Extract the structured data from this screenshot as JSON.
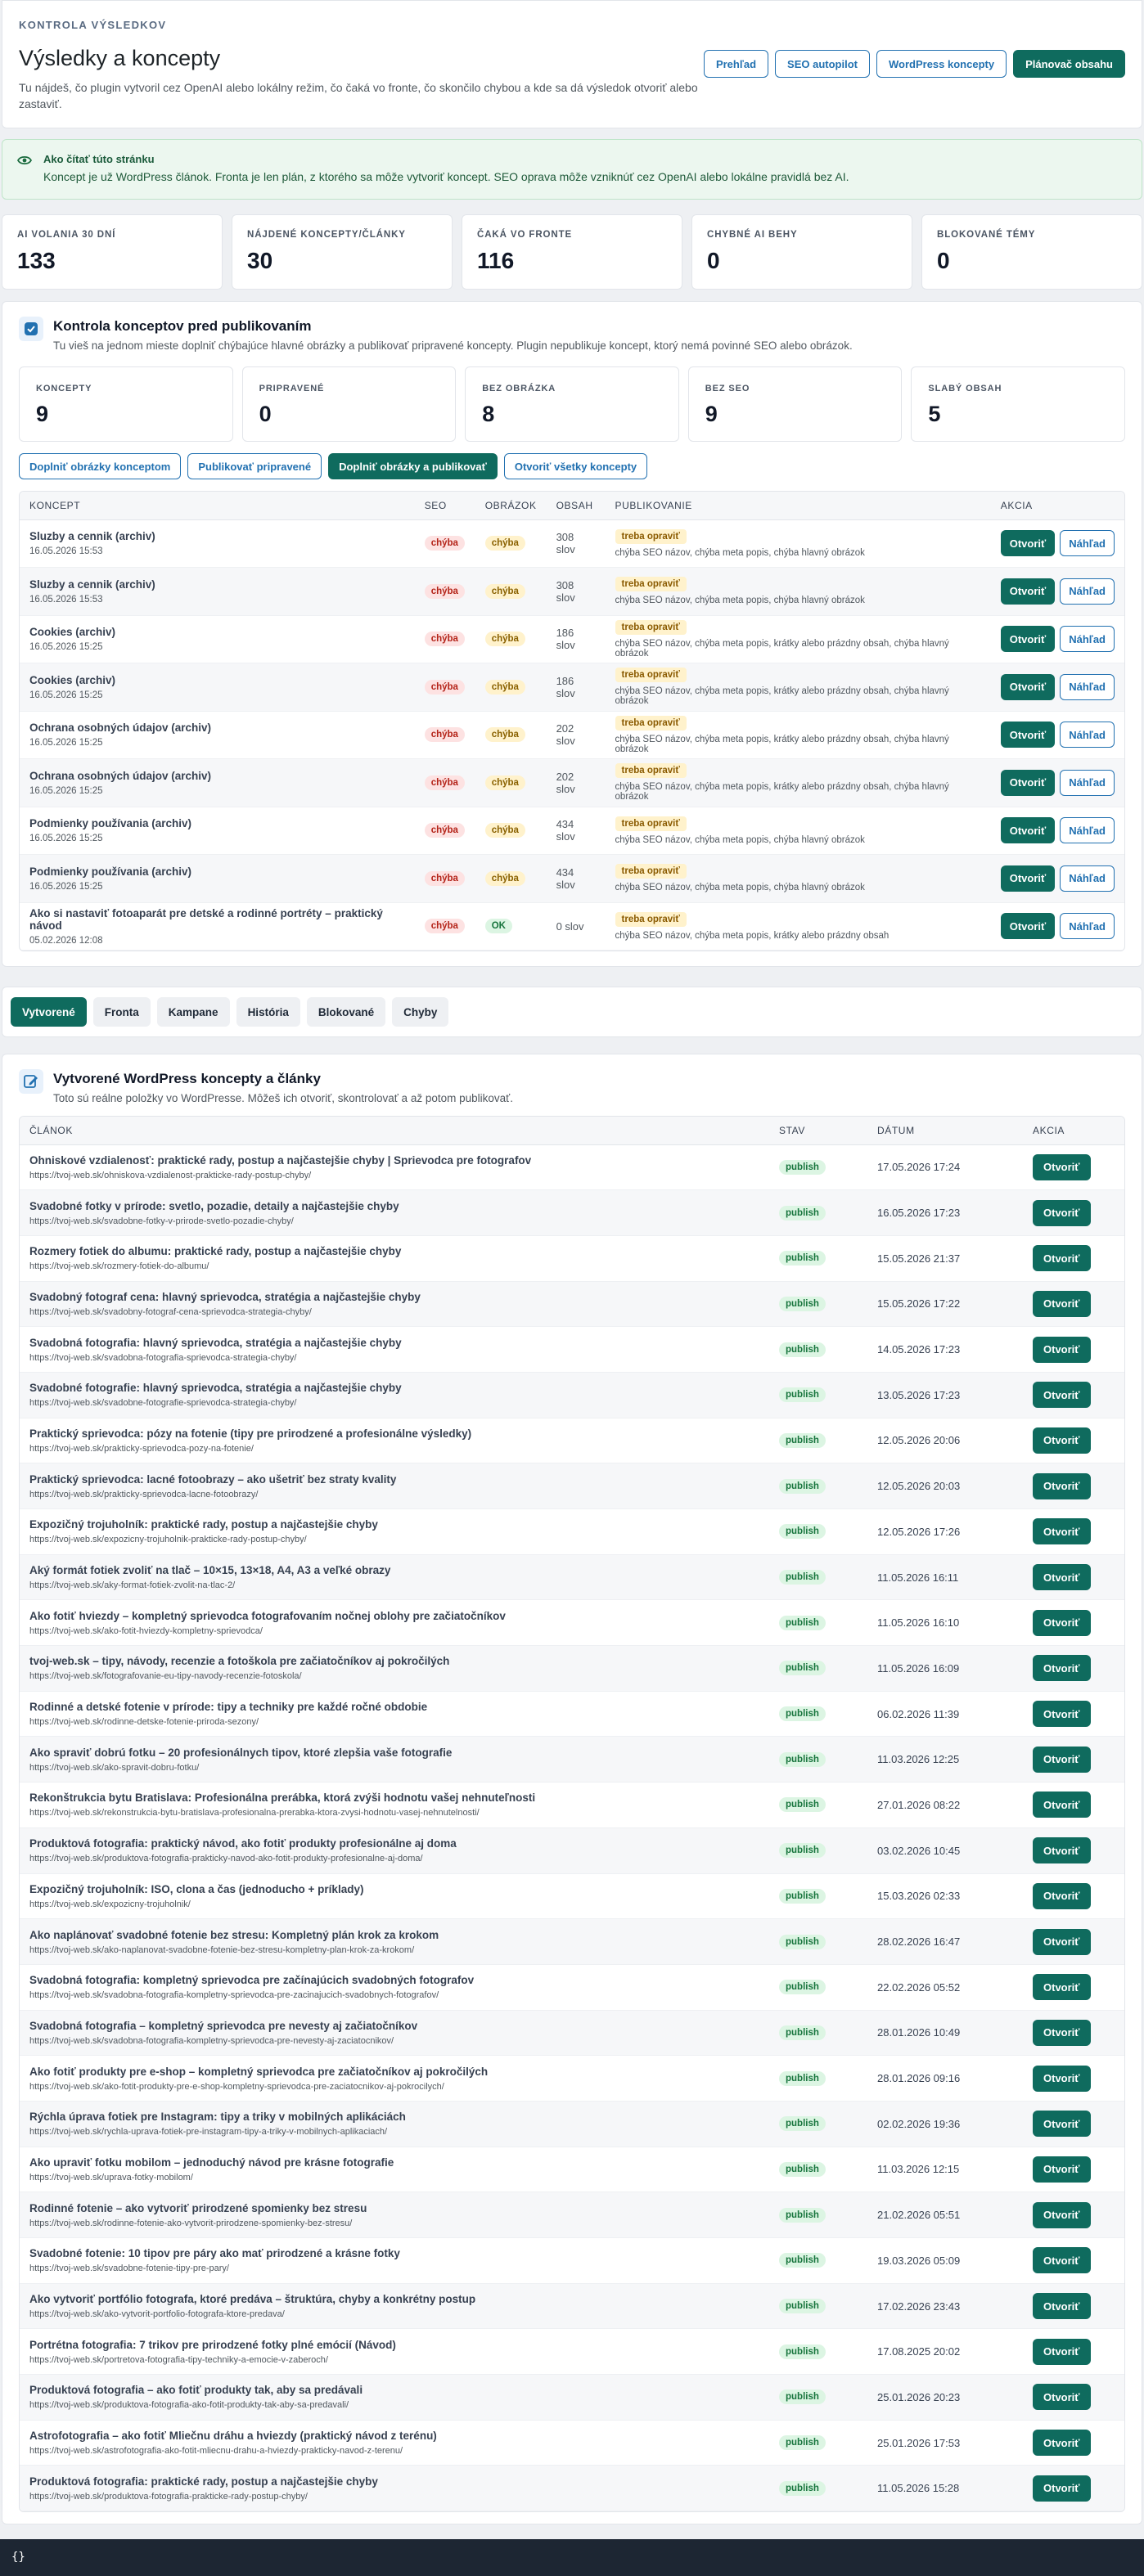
{
  "header": {
    "eyebrow": "KONTROLA VÝSLEDKOV",
    "title": "Výsledky a koncepty",
    "subtitle": "Tu nájdeš, čo plugin vytvoril cez OpenAI alebo lokálny režim, čo čaká vo fronte, čo skončilo chybou a kde sa dá výsledok otvoriť alebo zastaviť.",
    "actions": [
      "Prehľad",
      "SEO autopilot",
      "WordPress koncepty",
      "Plánovač obsahu"
    ]
  },
  "notice": {
    "title": "Ako čítať túto stránku",
    "text": "Koncept je už WordPress článok. Fronta je len plán, z ktorého sa môže vytvoriť koncept. SEO oprava môže vzniknúť cez OpenAI alebo lokálne pravidlá bez AI."
  },
  "stats": [
    {
      "label": "AI VOLANIA 30 DNÍ",
      "value": "133"
    },
    {
      "label": "NÁJDENÉ KONCEPTY/ČLÁNKY",
      "value": "30"
    },
    {
      "label": "ČAKÁ VO FRONTE",
      "value": "116"
    },
    {
      "label": "CHYBNÉ AI BEHY",
      "value": "0"
    },
    {
      "label": "BLOKOVANÉ TÉMY",
      "value": "0"
    }
  ],
  "review": {
    "title": "Kontrola konceptov pred publikovaním",
    "subtitle": "Tu vieš na jednom mieste doplniť chýbajúce hlavné obrázky a publikovať pripravené koncepty. Plugin nepublikuje koncept, ktorý nemá povinné SEO alebo obrázok.",
    "stats": [
      {
        "label": "KONCEPTY",
        "value": "9"
      },
      {
        "label": "PRIPRAVENÉ",
        "value": "0"
      },
      {
        "label": "BEZ OBRÁZKA",
        "value": "8"
      },
      {
        "label": "BEZ SEO",
        "value": "9"
      },
      {
        "label": "SLABÝ OBSAH",
        "value": "5"
      }
    ],
    "bulk_actions": [
      "Doplniť obrázky konceptom",
      "Publikovať pripravené",
      "Doplniť obrázky a publikovať",
      "Otvoriť všetky koncepty"
    ],
    "columns": [
      "KONCEPT",
      "SEO",
      "OBRÁZOK",
      "OBSAH",
      "PUBLIKOVANIE",
      "AKCIA"
    ],
    "open_label": "Otvoriť",
    "preview_label": "Náhľad",
    "rows": [
      {
        "title": "Sluzby a cennik (archiv)",
        "date": "16.05.2026 15:53",
        "seo": "chýba",
        "image": "chýba",
        "content": "308 slov",
        "status": "treba opraviť",
        "note": "chýba SEO názov, chýba meta popis, chýba hlavný obrázok"
      },
      {
        "title": "Sluzby a cennik (archiv)",
        "date": "16.05.2026 15:53",
        "seo": "chýba",
        "image": "chýba",
        "content": "308 slov",
        "status": "treba opraviť",
        "note": "chýba SEO názov, chýba meta popis, chýba hlavný obrázok"
      },
      {
        "title": "Cookies (archiv)",
        "date": "16.05.2026 15:25",
        "seo": "chýba",
        "image": "chýba",
        "content": "186 slov",
        "status": "treba opraviť",
        "note": "chýba SEO názov, chýba meta popis, krátky alebo prázdny obsah, chýba hlavný obrázok"
      },
      {
        "title": "Cookies (archiv)",
        "date": "16.05.2026 15:25",
        "seo": "chýba",
        "image": "chýba",
        "content": "186 slov",
        "status": "treba opraviť",
        "note": "chýba SEO názov, chýba meta popis, krátky alebo prázdny obsah, chýba hlavný obrázok"
      },
      {
        "title": "Ochrana osobných údajov (archiv)",
        "date": "16.05.2026 15:25",
        "seo": "chýba",
        "image": "chýba",
        "content": "202 slov",
        "status": "treba opraviť",
        "note": "chýba SEO názov, chýba meta popis, krátky alebo prázdny obsah, chýba hlavný obrázok"
      },
      {
        "title": "Ochrana osobných údajov (archiv)",
        "date": "16.05.2026 15:25",
        "seo": "chýba",
        "image": "chýba",
        "content": "202 slov",
        "status": "treba opraviť",
        "note": "chýba SEO názov, chýba meta popis, krátky alebo prázdny obsah, chýba hlavný obrázok"
      },
      {
        "title": "Podmienky používania (archiv)",
        "date": "16.05.2026 15:25",
        "seo": "chýba",
        "image": "chýba",
        "content": "434 slov",
        "status": "treba opraviť",
        "note": "chýba SEO názov, chýba meta popis, chýba hlavný obrázok"
      },
      {
        "title": "Podmienky používania (archiv)",
        "date": "16.05.2026 15:25",
        "seo": "chýba",
        "image": "chýba",
        "content": "434 slov",
        "status": "treba opraviť",
        "note": "chýba SEO názov, chýba meta popis, chýba hlavný obrázok"
      },
      {
        "title": "Ako si nastaviť fotoaparát pre detské a rodinné portréty – praktický návod",
        "date": "05.02.2026 12:08",
        "seo": "chýba",
        "image": "OK",
        "content": "0 slov",
        "status": "treba opraviť",
        "note": "chýba SEO názov, chýba meta popis, krátky alebo prázdny obsah"
      }
    ]
  },
  "tabs": [
    "Vytvorené",
    "Fronta",
    "Kampane",
    "História",
    "Blokované",
    "Chyby"
  ],
  "created": {
    "title": "Vytvorené WordPress koncepty a články",
    "subtitle": "Toto sú reálne položky vo WordPresse. Môžeš ich otvoriť, skontrolovať a až potom publikovať.",
    "columns": [
      "ČLÁNOK",
      "STAV",
      "DÁTUM",
      "AKCIA"
    ],
    "open_label": "Otvoriť",
    "rows": [
      {
        "title": "Ohniskové vzdialenosť: praktické rady, postup a najčastejšie chyby | Sprievodca pre fotografov",
        "url": "https://tvoj-web.sk/ohniskova-vzdialenost-prakticke-rady-postup-chyby/",
        "status": "publish",
        "date": "17.05.2026 17:24"
      },
      {
        "title": "Svadobné fotky v prírode: svetlo, pozadie, detaily a najčastejšie chyby",
        "url": "https://tvoj-web.sk/svadobne-fotky-v-prirode-svetlo-pozadie-chyby/",
        "status": "publish",
        "date": "16.05.2026 17:23"
      },
      {
        "title": "Rozmery fotiek do albumu: praktické rady, postup a najčastejšie chyby",
        "url": "https://tvoj-web.sk/rozmery-fotiek-do-albumu/",
        "status": "publish",
        "date": "15.05.2026 21:37"
      },
      {
        "title": "Svadobný fotograf cena: hlavný sprievodca, stratégia a najčastejšie chyby",
        "url": "https://tvoj-web.sk/svadobny-fotograf-cena-sprievodca-strategia-chyby/",
        "status": "publish",
        "date": "15.05.2026 17:22"
      },
      {
        "title": "Svadobná fotografia: hlavný sprievodca, stratégia a najčastejšie chyby",
        "url": "https://tvoj-web.sk/svadobna-fotografia-sprievodca-strategia-chyby/",
        "status": "publish",
        "date": "14.05.2026 17:23"
      },
      {
        "title": "Svadobné fotografie: hlavný sprievodca, stratégia a najčastejšie chyby",
        "url": "https://tvoj-web.sk/svadobne-fotografie-sprievodca-strategia-chyby/",
        "status": "publish",
        "date": "13.05.2026 17:23"
      },
      {
        "title": "Praktický sprievodca: pózy na fotenie (tipy pre prirodzené a profesionálne výsledky)",
        "url": "https://tvoj-web.sk/prakticky-sprievodca-pozy-na-fotenie/",
        "status": "publish",
        "date": "12.05.2026 20:06"
      },
      {
        "title": "Praktický sprievodca: lacné fotoobrazy – ako ušetriť bez straty kvality",
        "url": "https://tvoj-web.sk/prakticky-sprievodca-lacne-fotoobrazy/",
        "status": "publish",
        "date": "12.05.2026 20:03"
      },
      {
        "title": "Expozičný trojuholník: praktické rady, postup a najčastejšie chyby",
        "url": "https://tvoj-web.sk/expozicny-trojuholnik-prakticke-rady-postup-chyby/",
        "status": "publish",
        "date": "12.05.2026 17:26"
      },
      {
        "title": "Aký formát fotiek zvoliť na tlač – 10×15, 13×18, A4, A3 a veľké obrazy",
        "url": "https://tvoj-web.sk/aky-format-fotiek-zvolit-na-tlac-2/",
        "status": "publish",
        "date": "11.05.2026 16:11"
      },
      {
        "title": "Ako fotiť hviezdy – kompletný sprievodca fotografovaním nočnej oblohy pre začiatočníkov",
        "url": "https://tvoj-web.sk/ako-fotit-hviezdy-kompletny-sprievodca/",
        "status": "publish",
        "date": "11.05.2026 16:10"
      },
      {
        "title": "tvoj-web.sk – tipy, návody, recenzie a fotoškola pre začiatočníkov aj pokročilých",
        "url": "https://tvoj-web.sk/fotografovanie-eu-tipy-navody-recenzie-fotoskola/",
        "status": "publish",
        "date": "11.05.2026 16:09"
      },
      {
        "title": "Rodinné a detské fotenie v prírode: tipy a techniky pre každé ročné obdobie",
        "url": "https://tvoj-web.sk/rodinne-detske-fotenie-priroda-sezony/",
        "status": "publish",
        "date": "06.02.2026 11:39"
      },
      {
        "title": "Ako spraviť dobrú fotku – 20 profesionálnych tipov, ktoré zlepšia vaše fotografie",
        "url": "https://tvoj-web.sk/ako-spravit-dobru-fotku/",
        "status": "publish",
        "date": "11.03.2026 12:25"
      },
      {
        "title": "Rekonštrukcia bytu Bratislava: Profesionálna prerábka, ktorá zvýši hodnotu vašej nehnuteľnosti",
        "url": "https://tvoj-web.sk/rekonstrukcia-bytu-bratislava-profesionalna-prerabka-ktora-zvysi-hodnotu-vasej-nehnutelnosti/",
        "status": "publish",
        "date": "27.01.2026 08:22"
      },
      {
        "title": "Produktová fotografia: praktický návod, ako fotiť produkty profesionálne aj doma",
        "url": "https://tvoj-web.sk/produktova-fotografia-prakticky-navod-ako-fotit-produkty-profesionalne-aj-doma/",
        "status": "publish",
        "date": "03.02.2026 10:45"
      },
      {
        "title": "Expozičný trojuholník: ISO, clona a čas (jednoducho + príklady)",
        "url": "https://tvoj-web.sk/expozicny-trojuholnik/",
        "status": "publish",
        "date": "15.03.2026 02:33"
      },
      {
        "title": "Ako naplánovať svadobné fotenie bez stresu: Kompletný plán krok za krokom",
        "url": "https://tvoj-web.sk/ako-naplanovat-svadobne-fotenie-bez-stresu-kompletny-plan-krok-za-krokom/",
        "status": "publish",
        "date": "28.02.2026 16:47"
      },
      {
        "title": "Svadobná fotografia: kompletný sprievodca pre začínajúcich svadobných fotografov",
        "url": "https://tvoj-web.sk/svadobna-fotografia-kompletny-sprievodca-pre-zacinajucich-svadobnych-fotografov/",
        "status": "publish",
        "date": "22.02.2026 05:52"
      },
      {
        "title": "Svadobná fotografia – kompletný sprievodca pre nevesty aj začiatočníkov",
        "url": "https://tvoj-web.sk/svadobna-fotografia-kompletny-sprievodca-pre-nevesty-aj-zaciatocnikov/",
        "status": "publish",
        "date": "28.01.2026 10:49"
      },
      {
        "title": "Ako fotiť produkty pre e-shop – kompletný sprievodca pre začiatočníkov aj pokročilých",
        "url": "https://tvoj-web.sk/ako-fotit-produkty-pre-e-shop-kompletny-sprievodca-pre-zaciatocnikov-aj-pokrocilych/",
        "status": "publish",
        "date": "28.01.2026 09:16"
      },
      {
        "title": "Rýchla úprava fotiek pre Instagram: tipy a triky v mobilných aplikáciách",
        "url": "https://tvoj-web.sk/rychla-uprava-fotiek-pre-instagram-tipy-a-triky-v-mobilnych-aplikaciach/",
        "status": "publish",
        "date": "02.02.2026 19:36"
      },
      {
        "title": "Ako upraviť fotku mobilom – jednoduchý návod pre krásne fotografie",
        "url": "https://tvoj-web.sk/uprava-fotky-mobilom/",
        "status": "publish",
        "date": "11.03.2026 12:15"
      },
      {
        "title": "Rodinné fotenie – ako vytvoriť prirodzené spomienky bez stresu",
        "url": "https://tvoj-web.sk/rodinne-fotenie-ako-vytvorit-prirodzene-spomienky-bez-stresu/",
        "status": "publish",
        "date": "21.02.2026 05:51"
      },
      {
        "title": "Svadobné fotenie: 10 tipov pre páry ako mať prirodzené a krásne fotky",
        "url": "https://tvoj-web.sk/svadobne-fotenie-tipy-pre-pary/",
        "status": "publish",
        "date": "19.03.2026 05:09"
      },
      {
        "title": "Ako vytvoriť portfólio fotografa, ktoré predáva – štruktúra, chyby a konkrétny postup",
        "url": "https://tvoj-web.sk/ako-vytvorit-portfolio-fotografa-ktore-predava/",
        "status": "publish",
        "date": "17.02.2026 23:43"
      },
      {
        "title": "Portrétna fotografia: 7 trikov pre prirodzené fotky plné emócií (Návod)",
        "url": "https://tvoj-web.sk/portretova-fotografia-tipy-techniky-a-emocie-v-zaberoch/",
        "status": "publish",
        "date": "17.08.2025 20:02"
      },
      {
        "title": "Produktová fotografia – ako fotiť produkty tak, aby sa predávali",
        "url": "https://tvoj-web.sk/produktova-fotografia-ako-fotit-produkty-tak-aby-sa-predavali/",
        "status": "publish",
        "date": "25.01.2026 20:23"
      },
      {
        "title": "Astrofotografia – ako fotiť Mliečnu dráhu a hviezdy (praktický návod z terénu)",
        "url": "https://tvoj-web.sk/astrofotografia-ako-fotit-mliecnu-drahu-a-hviezdy-prakticky-navod-z-terenu/",
        "status": "publish",
        "date": "25.01.2026 17:53"
      },
      {
        "title": "Produktová fotografia: praktické rady, postup a najčastejšie chyby",
        "url": "https://tvoj-web.sk/produktova-fotografia-prakticke-rady-postup-chyby/",
        "status": "publish",
        "date": "11.05.2026 15:28"
      }
    ]
  },
  "footer": {
    "text": "{}"
  },
  "colors": {
    "primary": "#0f6b5e",
    "link": "#2271b1",
    "danger_bg": "#fde2e2",
    "warn_bg": "#fff2cc",
    "ok_bg": "#dcf5e3"
  }
}
